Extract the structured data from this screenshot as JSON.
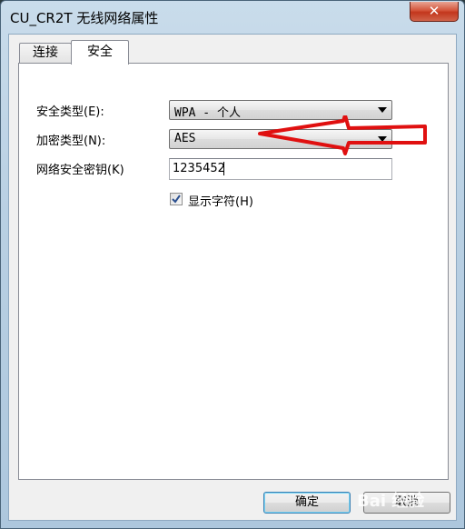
{
  "window": {
    "title": "CU_CR2T 无线网络属性",
    "close_glyph": "✕"
  },
  "tabs": [
    {
      "label": "连接",
      "active": false
    },
    {
      "label": "安全",
      "active": true
    }
  ],
  "form": {
    "security_type_label": "安全类型(E):",
    "security_type_value": "WPA - 个人",
    "encryption_type_label": "加密类型(N):",
    "encryption_type_value": "AES",
    "key_label": "网络安全密钥(K)",
    "key_value": "1235452",
    "show_chars_label": "显示字符(H)",
    "show_chars_checked": true
  },
  "buttons": {
    "ok_label": "确定",
    "cancel_label": "取消"
  },
  "watermark": "Bai 经验",
  "colors": {
    "annotation_arrow": "#e01010",
    "title_bar": "#b9d0e3",
    "close_button": "#c3361c",
    "checkmark": "#2a4f8f"
  }
}
